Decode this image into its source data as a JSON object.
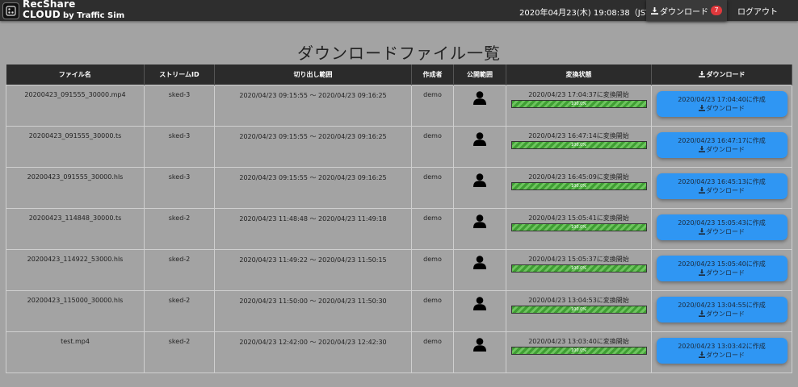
{
  "header": {
    "brand_line1": "RecShare",
    "brand_line2": "CLOUD",
    "brand_by": "by Traffic Sim",
    "datetime": "2020年04月23(木) 19:08:38（JST）",
    "download_label": "ダウンロード",
    "download_badge": "7",
    "logout_label": "ログアウト"
  },
  "page_title": "ダウンロードファイル一覧",
  "table": {
    "headers": {
      "filename": "ファイル名",
      "stream": "ストリームID",
      "range": "切り出し範囲",
      "creator": "作成者",
      "scope": "公開範囲",
      "status": "変換状態",
      "download": "ダウンロード"
    },
    "rows": [
      {
        "file": "20200423_091555_30000.mp4",
        "stream": "sked-3",
        "range": "2020/04/23 09:15:55 ～ 2020/04/23 09:16:25",
        "creator": "demo",
        "status": "2020/04/23 17:04:37に変換開始",
        "progress": "100.0%",
        "created": "2020/04/23 17:04:40に作成",
        "dl": "ダウンロード"
      },
      {
        "file": "20200423_091555_30000.ts",
        "stream": "sked-3",
        "range": "2020/04/23 09:15:55 ～ 2020/04/23 09:16:25",
        "creator": "demo",
        "status": "2020/04/23 16:47:14に変換開始",
        "progress": "100.0%",
        "created": "2020/04/23 16:47:17に作成",
        "dl": "ダウンロード"
      },
      {
        "file": "20200423_091555_30000.hls",
        "stream": "sked-3",
        "range": "2020/04/23 09:15:55 ～ 2020/04/23 09:16:25",
        "creator": "demo",
        "status": "2020/04/23 16:45:09に変換開始",
        "progress": "100.0%",
        "created": "2020/04/23 16:45:13に作成",
        "dl": "ダウンロード"
      },
      {
        "file": "20200423_114848_30000.ts",
        "stream": "sked-2",
        "range": "2020/04/23 11:48:48 ～ 2020/04/23 11:49:18",
        "creator": "demo",
        "status": "2020/04/23 15:05:41に変換開始",
        "progress": "100.0%",
        "created": "2020/04/23 15:05:43に作成",
        "dl": "ダウンロード"
      },
      {
        "file": "20200423_114922_53000.hls",
        "stream": "sked-2",
        "range": "2020/04/23 11:49:22 ～ 2020/04/23 11:50:15",
        "creator": "demo",
        "status": "2020/04/23 15:05:37に変換開始",
        "progress": "100.0%",
        "created": "2020/04/23 15:05:40に作成",
        "dl": "ダウンロード"
      },
      {
        "file": "20200423_115000_30000.hls",
        "stream": "sked-2",
        "range": "2020/04/23 11:50:00 ～ 2020/04/23 11:50:30",
        "creator": "demo",
        "status": "2020/04/23 13:04:53に変換開始",
        "progress": "100.0%",
        "created": "2020/04/23 13:04:55に作成",
        "dl": "ダウンロード"
      },
      {
        "file": "test.mp4",
        "stream": "sked-2",
        "range": "2020/04/23 12:42:00 ～ 2020/04/23 12:42:30",
        "creator": "demo",
        "status": "2020/04/23 13:03:40に変換開始",
        "progress": "100.0%",
        "created": "2020/04/23 13:03:42に作成",
        "dl": "ダウンロード"
      }
    ]
  },
  "icons": {
    "scope_icon": "user-icon",
    "download_icon": "download-icon",
    "logo_icon": "logo-icon"
  },
  "colors": {
    "header_bg": "#2e2e2e",
    "badge": "#e0383c",
    "button": "#2f96f3",
    "progress": "#3f9e33"
  }
}
